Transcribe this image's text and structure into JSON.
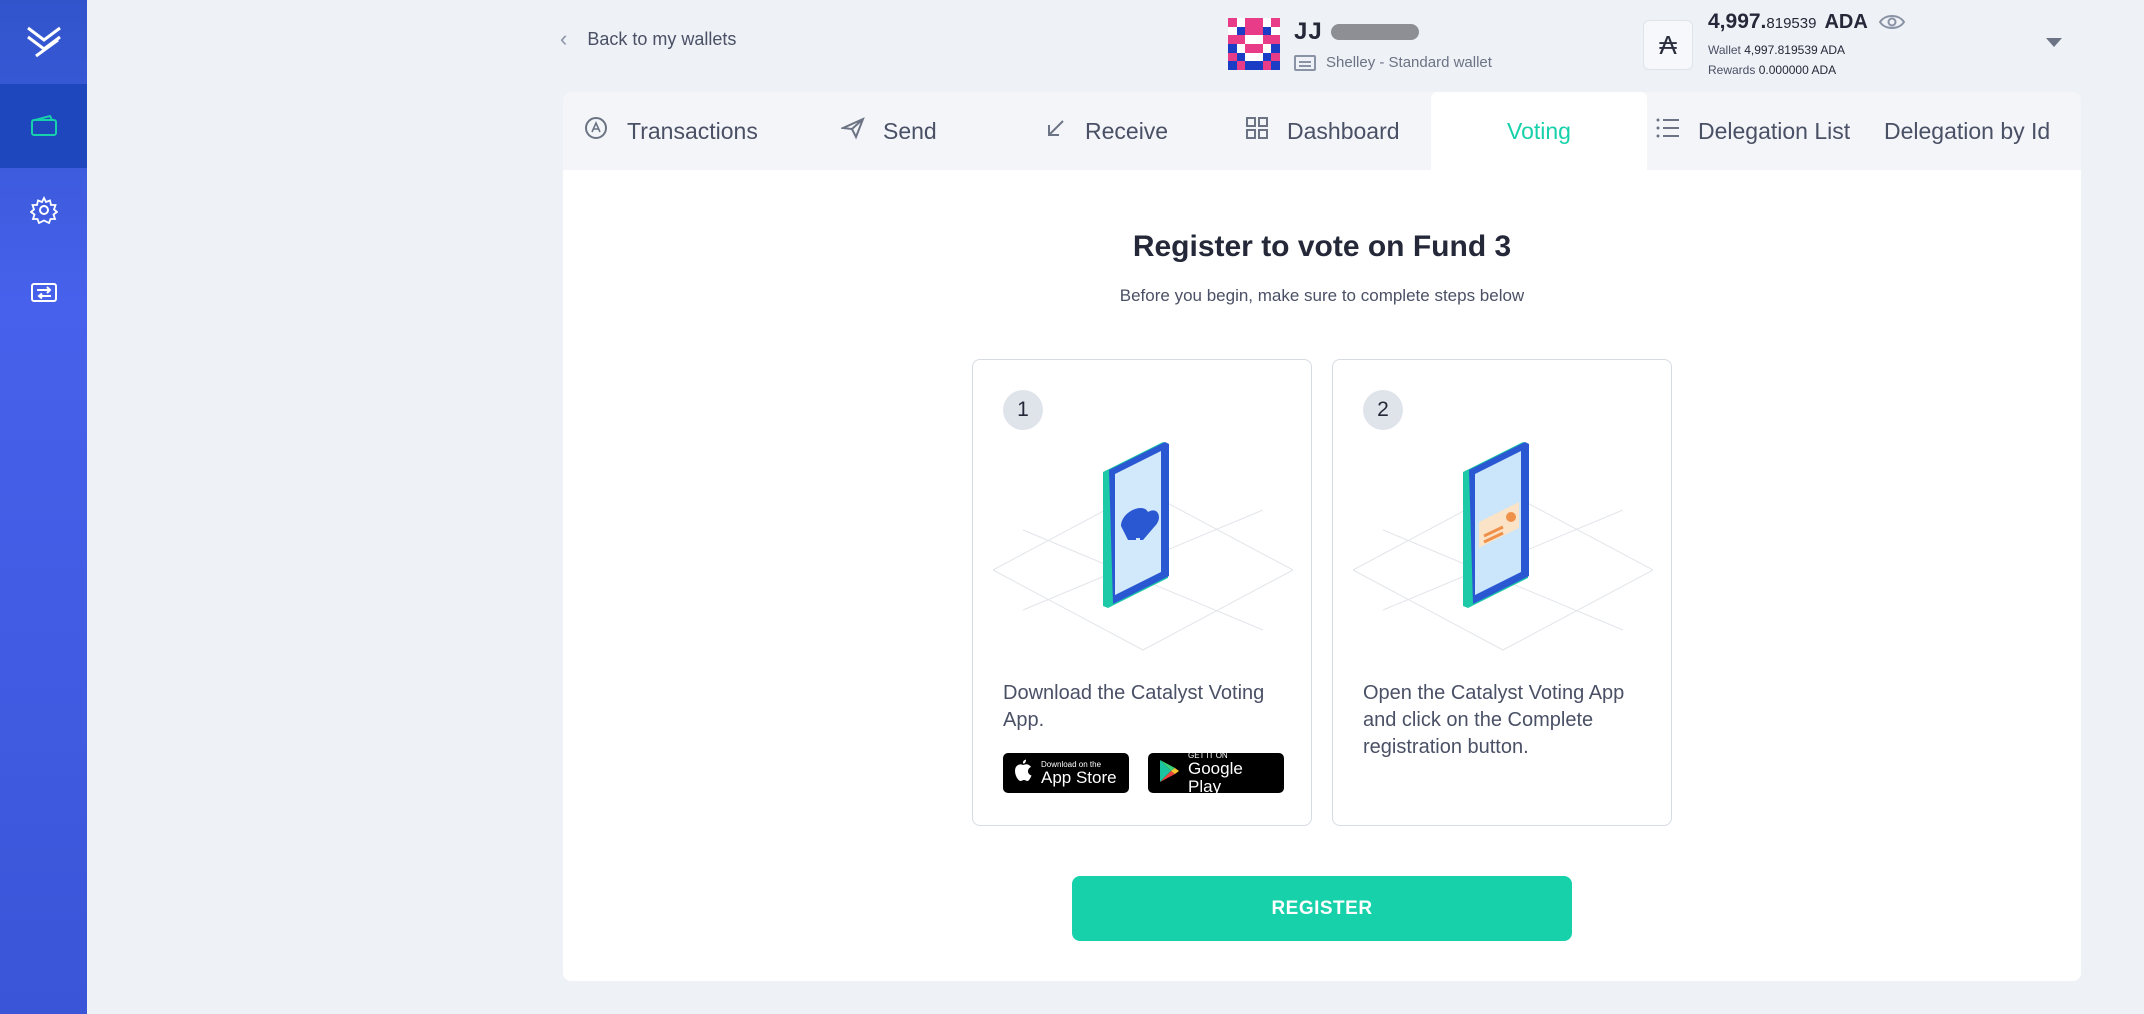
{
  "sidebar": {
    "logo": "yoroi-logo-icon",
    "items": [
      {
        "name": "wallets",
        "icon": "wallet-icon",
        "active": true
      },
      {
        "name": "settings",
        "icon": "gear-icon",
        "active": false
      },
      {
        "name": "transfer",
        "icon": "transfer-icon",
        "active": false
      }
    ]
  },
  "header": {
    "back_label": "Back to my wallets",
    "wallet_name": "JJ",
    "wallet_type": "Shelley - Standard wallet",
    "balance_int": "4,997.",
    "balance_dec": "819539",
    "balance_unit": "ADA",
    "wallet_label": "Wallet",
    "wallet_int": "4,997.",
    "wallet_dec": "819539",
    "wallet_unit": "ADA",
    "rewards_label": "Rewards",
    "rewards_int": "0.",
    "rewards_dec": "000000",
    "rewards_unit": "ADA",
    "ada_symbol": "₳"
  },
  "tabs": [
    {
      "label": "Transactions",
      "icon": "transactions-icon"
    },
    {
      "label": "Send",
      "icon": "send-icon"
    },
    {
      "label": "Receive",
      "icon": "receive-icon"
    },
    {
      "label": "Dashboard",
      "icon": "dashboard-icon"
    },
    {
      "label": "Voting",
      "icon": "",
      "active": true
    },
    {
      "label": "Delegation List",
      "icon": "list-icon"
    },
    {
      "label": "Delegation by Id",
      "icon": ""
    }
  ],
  "main": {
    "title": "Register to vote on Fund 3",
    "subtitle": "Before you begin, make sure to complete steps below",
    "steps": [
      {
        "number": "1",
        "text": "Download the Catalyst Voting App."
      },
      {
        "number": "2",
        "text": "Open the Catalyst Voting App and click on the Complete registration button."
      }
    ],
    "app_store": {
      "small": "Download on the",
      "big": "App Store"
    },
    "google_play": {
      "small": "GET IT ON",
      "big": "Google Play"
    },
    "register_label": "REGISTER"
  },
  "colors": {
    "accent": "#17d1aa",
    "sidebar": "#3b55d8",
    "sidebar_active": "#1e46bd",
    "background": "#eef1f5"
  }
}
